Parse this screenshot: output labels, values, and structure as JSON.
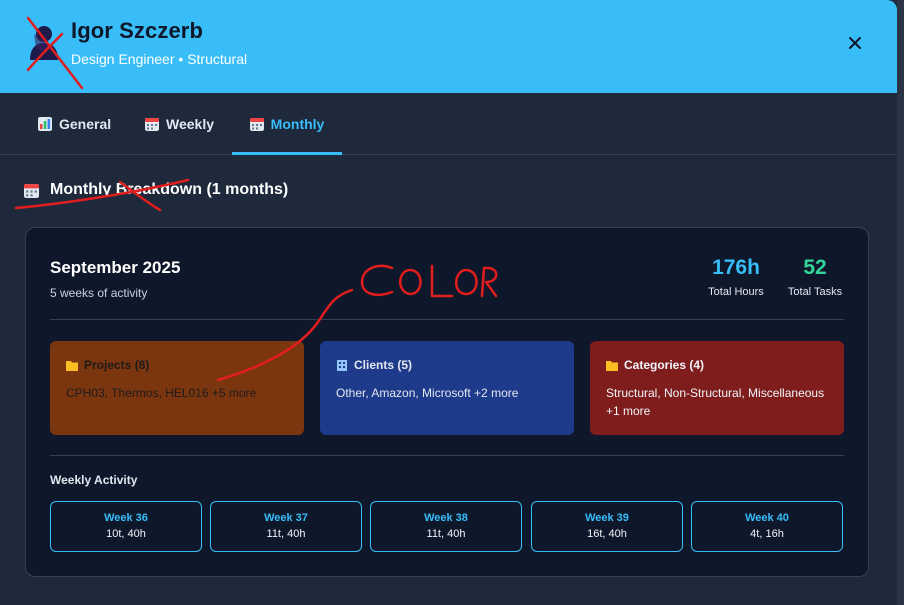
{
  "header": {
    "name": "Igor Szczerb",
    "role": "Design Engineer • Structural",
    "background": "#38bdf8"
  },
  "tabs": [
    {
      "label": "General",
      "icon": "bar-chart-icon",
      "active": false
    },
    {
      "label": "Weekly",
      "icon": "calendar-icon",
      "active": false
    },
    {
      "label": "Monthly",
      "icon": "calendar-icon",
      "active": true
    }
  ],
  "section": {
    "title": "Monthly Breakdown (1 months)"
  },
  "month": {
    "title": "September 2025",
    "subtitle": "5 weeks of activity",
    "stats": [
      {
        "value": "176h",
        "label": "Total Hours",
        "color": "#38bdf8"
      },
      {
        "value": "52",
        "label": "Total Tasks",
        "color": "#34d399"
      }
    ],
    "boxes": [
      {
        "title": "Projects (8)",
        "items": "CPH03, Thermos, HEL016 +5 more",
        "icon": "folder-icon",
        "bg": "#7c360f"
      },
      {
        "title": "Clients (5)",
        "items": "Other, Amazon, Microsoft +2 more",
        "icon": "building-icon",
        "bg": "#1e3a8a"
      },
      {
        "title": "Categories (4)",
        "items": "Structural, Non-Structural, Miscellaneous +1 more",
        "icon": "folder-icon",
        "bg": "#7f1d1d"
      }
    ],
    "weekly_label": "Weekly Activity",
    "weeks": [
      {
        "name": "Week 36",
        "value": "10t, 40h"
      },
      {
        "name": "Week 37",
        "value": "11t, 40h"
      },
      {
        "name": "Week 38",
        "value": "11t, 40h"
      },
      {
        "name": "Week 39",
        "value": "16t, 40h"
      },
      {
        "name": "Week 40",
        "value": "4t, 16h"
      }
    ]
  },
  "annotation": {
    "text": "COLOR",
    "color": "#e11d1d"
  }
}
